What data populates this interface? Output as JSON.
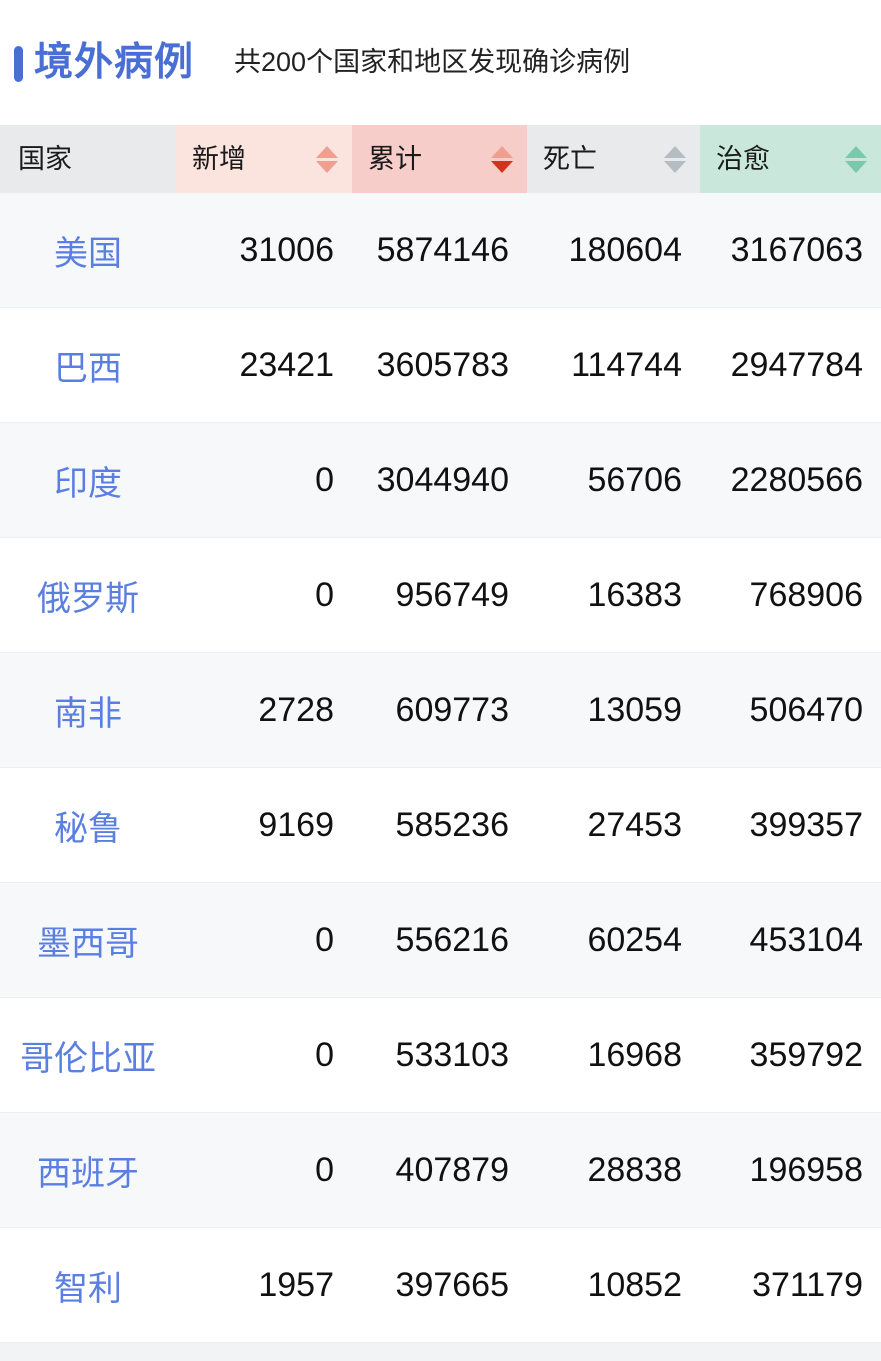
{
  "header": {
    "title": "境外病例",
    "subtitle": "共200个国家和地区发现确诊病例",
    "accent_color": "#4a6fd4"
  },
  "table": {
    "columns": [
      {
        "key": "country",
        "label": "国家",
        "sortable": false,
        "bg": "#e9eaec",
        "arrow_color": ""
      },
      {
        "key": "new",
        "label": "新增",
        "sortable": true,
        "bg": "#fbe3de",
        "arrow_color": "#ef9e90",
        "sort_state": "none"
      },
      {
        "key": "total",
        "label": "累计",
        "sortable": true,
        "bg": "#f7cdc9",
        "arrow_color": "#ef9e90",
        "sort_state": "desc",
        "active_arrow_color": "#d0351c"
      },
      {
        "key": "death",
        "label": "死亡",
        "sortable": true,
        "bg": "#e9eaec",
        "arrow_color": "#b5bcc2",
        "sort_state": "none"
      },
      {
        "key": "cured",
        "label": "治愈",
        "sortable": true,
        "bg": "#c9e7db",
        "arrow_color": "#7cc8ad",
        "sort_state": "none"
      }
    ],
    "rows": [
      {
        "country": "美国",
        "new": "31006",
        "total": "5874146",
        "death": "180604",
        "cured": "3167063"
      },
      {
        "country": "巴西",
        "new": "23421",
        "total": "3605783",
        "death": "114744",
        "cured": "2947784"
      },
      {
        "country": "印度",
        "new": "0",
        "total": "3044940",
        "death": "56706",
        "cured": "2280566"
      },
      {
        "country": "俄罗斯",
        "new": "0",
        "total": "956749",
        "death": "16383",
        "cured": "768906"
      },
      {
        "country": "南非",
        "new": "2728",
        "total": "609773",
        "death": "13059",
        "cured": "506470"
      },
      {
        "country": "秘鲁",
        "new": "9169",
        "total": "585236",
        "death": "27453",
        "cured": "399357"
      },
      {
        "country": "墨西哥",
        "new": "0",
        "total": "556216",
        "death": "60254",
        "cured": "453104"
      },
      {
        "country": "哥伦比亚",
        "new": "0",
        "total": "533103",
        "death": "16968",
        "cured": "359792"
      },
      {
        "country": "西班牙",
        "new": "0",
        "total": "407879",
        "death": "28838",
        "cured": "196958"
      },
      {
        "country": "智利",
        "new": "1957",
        "total": "397665",
        "death": "10852",
        "cured": "371179"
      }
    ]
  }
}
